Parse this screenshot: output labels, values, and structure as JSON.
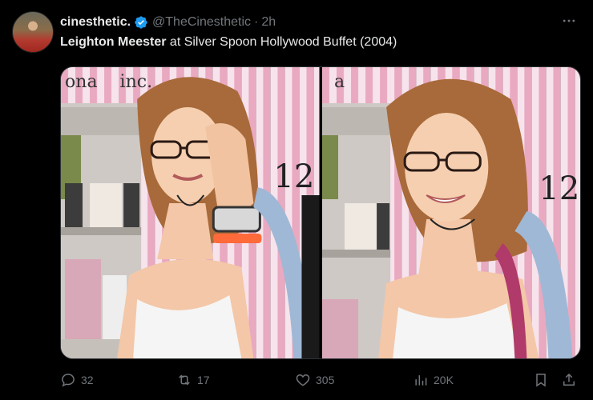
{
  "tweet": {
    "author_name": "cinesthetic.",
    "handle": "@TheCinesthetic",
    "separator": "·",
    "time": "2h",
    "text_bold": "Leighton Meester",
    "text_rest": " at Silver Spoon Hollywood Buffet (2004)"
  },
  "actions": {
    "replies": "32",
    "reposts": "17",
    "likes": "305",
    "views": "20K"
  },
  "media": {
    "photo1_sign": "ona    inc.",
    "photo1_number": "12",
    "photo2_sign": "a",
    "photo2_number": "12"
  },
  "colors": {
    "background": "#000000",
    "verified": "#1d9bf0",
    "muted": "#71767b",
    "text": "#e7e9ea"
  }
}
